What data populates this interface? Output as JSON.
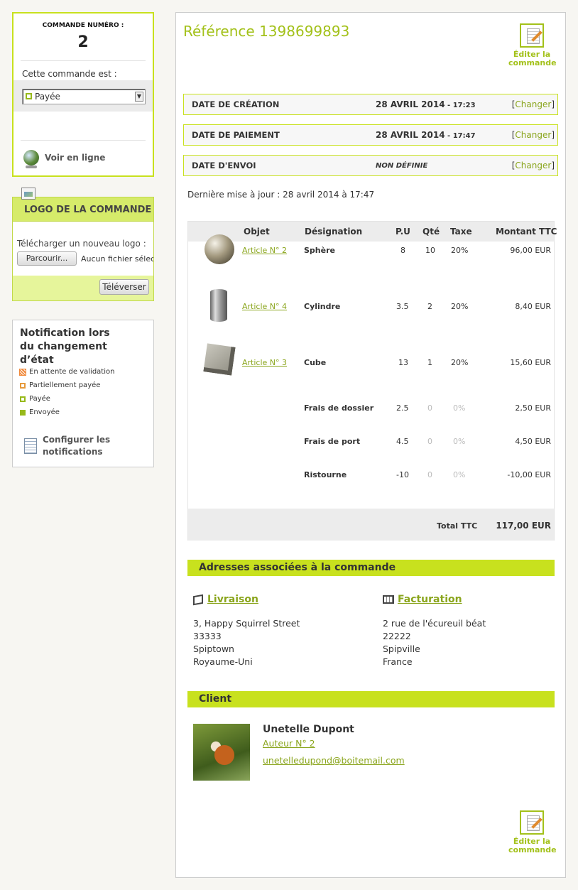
{
  "order_box": {
    "title": "COMMANDE NUMÉRO :",
    "number": "2",
    "status_label": "Cette commande est :",
    "status_value": "Payée",
    "online_label": "Voir en ligne"
  },
  "logo_box": {
    "title": "LOGO DE LA COMMANDE",
    "upload_label": "Télécharger un nouveau logo :",
    "browse_button": "Parcourir...",
    "no_file": "Aucun fichier sélectionné",
    "upload_button": "Téléverser"
  },
  "notif_box": {
    "title": "Notification lors du changement d’état",
    "legend": [
      {
        "label": "En attente de validation",
        "color": "#f08a3c"
      },
      {
        "label": "Partiellement payée",
        "color": "#e69a3d"
      },
      {
        "label": "Payée",
        "color": "#97b91a"
      },
      {
        "label": "Envoyée",
        "color": "#97b91a"
      }
    ],
    "configure": "Configurer les notifications"
  },
  "main": {
    "reference": "Référence 1398699893",
    "edit_label": "Éditer la commande",
    "dates": [
      {
        "key": "DATE DE CRÉATION",
        "date": "28 AVRIL 2014",
        "time": " - 17:23",
        "action": "Changer"
      },
      {
        "key": "DATE DE PAIEMENT",
        "date": "28 AVRIL 2014",
        "time": " - 17:47",
        "action": "Changer"
      },
      {
        "key": "DATE D'ENVOI",
        "undefined": "NON DÉFINIE",
        "action": "Changer"
      }
    ],
    "last_update": "Dernière mise à jour : 28 avril 2014 à 17:47"
  },
  "table": {
    "headers": [
      "Objet",
      "Désignation",
      "P.U",
      "Qté",
      "Taxe",
      "Montant TTC"
    ],
    "rows": [
      {
        "link": "Article N° 2",
        "name": "Sphère",
        "pu": "8",
        "qty": "10",
        "tax": "20%",
        "amount": "96,00 EUR",
        "image": "sphere"
      },
      {
        "link": "Article N° 4",
        "name": "Cylindre",
        "pu": "3.5",
        "qty": "2",
        "tax": "20%",
        "amount": "8,40 EUR",
        "image": "cylinder"
      },
      {
        "link": "Article N° 3",
        "name": "Cube",
        "pu": "13",
        "qty": "1",
        "tax": "20%",
        "amount": "15,60 EUR",
        "image": "cube"
      },
      {
        "name": "Frais de dossier",
        "pu": "2.5",
        "qty": "0",
        "tax": "0%",
        "amount": "2,50 EUR"
      },
      {
        "name": "Frais de port",
        "pu": "4.5",
        "qty": "0",
        "tax": "0%",
        "amount": "4,50 EUR"
      },
      {
        "name": "Ristourne",
        "pu": "-10",
        "qty": "0",
        "tax": "0%",
        "amount": "-10,00 EUR"
      }
    ],
    "total_label": "Total TTC",
    "total_value": "117,00 EUR"
  },
  "addresses": {
    "title": "Adresses associées à la commande",
    "delivery": {
      "label": "Livraison",
      "lines": [
        "3, Happy Squirrel Street",
        "33333",
        "Spiptown",
        "Royaume-Uni"
      ]
    },
    "billing": {
      "label": "Facturation",
      "lines": [
        "2 rue de l'écureuil béat",
        "22222",
        "Spipville",
        "France"
      ]
    }
  },
  "client": {
    "title": "Client",
    "name": "Unetelle Dupont",
    "author_link": "Auteur N° 2",
    "email": "unetelledupond@boitemail.com"
  },
  "colors": {
    "accent": "#c8e11e",
    "link": "#8aa51c",
    "title": "#a3c11a"
  }
}
